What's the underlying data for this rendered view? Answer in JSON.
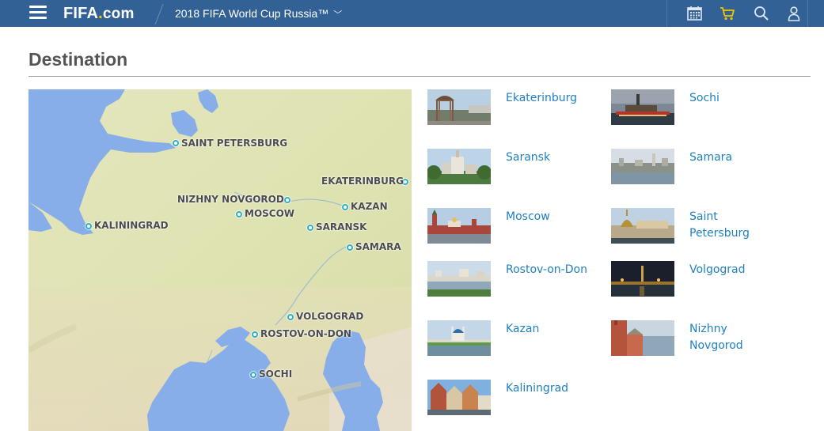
{
  "header": {
    "logo_main": "FIFA",
    "logo_dot": ".",
    "logo_suffix": "com",
    "edition": "2018 FIFA World Cup Russia™",
    "edition_chevron": "﹀",
    "icons": [
      "menu-icon",
      "calendar-icon",
      "cart-icon",
      "search-icon",
      "user-icon"
    ]
  },
  "page": {
    "title": "Destination"
  },
  "map": {
    "cities": [
      {
        "label": "SAINT PETERSBURG"
      },
      {
        "label": "EKATERINBURG"
      },
      {
        "label": "NIZHNY NOVGOROD"
      },
      {
        "label": "KAZAN"
      },
      {
        "label": "MOSCOW"
      },
      {
        "label": "KALININGRAD"
      },
      {
        "label": "SARANSK"
      },
      {
        "label": "SAMARA"
      },
      {
        "label": "VOLGOGRAD"
      },
      {
        "label": "ROSTOV-ON-DON"
      },
      {
        "label": "SOCHI"
      }
    ]
  },
  "destinations": {
    "left": [
      {
        "name": "Ekaterinburg"
      },
      {
        "name": "Saransk"
      },
      {
        "name": "Moscow"
      },
      {
        "name": "Rostov-on-Don"
      },
      {
        "name": "Kazan"
      },
      {
        "name": "Kaliningrad"
      }
    ],
    "right": [
      {
        "name": "Sochi"
      },
      {
        "name": "Samara"
      },
      {
        "name": "Saint Petersburg"
      },
      {
        "name": "Volgograd"
      },
      {
        "name": "Nizhny Novgorod"
      }
    ]
  },
  "colors": {
    "topbar": "#326295",
    "accent_dot": "#f6c500",
    "cart": "#f6c500",
    "link": "#1f7fc0",
    "marker": "#2fb0c8",
    "water": "#88aeea",
    "land": "#dfe3b4"
  }
}
